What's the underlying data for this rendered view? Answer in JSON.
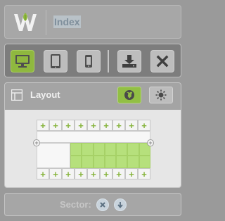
{
  "header": {
    "title": "Index",
    "logo_icon": "w-leaf-logo-icon"
  },
  "toolbar": {
    "buttons": [
      {
        "icon": "desktop-icon",
        "active": true
      },
      {
        "icon": "tablet-icon",
        "active": false
      },
      {
        "icon": "phone-icon",
        "active": false
      },
      {
        "icon": "download-icon",
        "active": false
      },
      {
        "icon": "close-icon",
        "active": false
      }
    ]
  },
  "layout": {
    "title": "Layout",
    "icon": "layout-icon",
    "globe_icon": "globe-icon",
    "sun_icon": "sun-icon",
    "plus_glyph": "+",
    "handle_glyph": "+"
  },
  "footer": {
    "label": "Sector:",
    "close_icon": "close-icon",
    "down_icon": "arrow-down-icon"
  },
  "colors": {
    "accent": "#8fb83f",
    "slot_fill": "#b6e07c",
    "background": "#9a9a9a"
  }
}
